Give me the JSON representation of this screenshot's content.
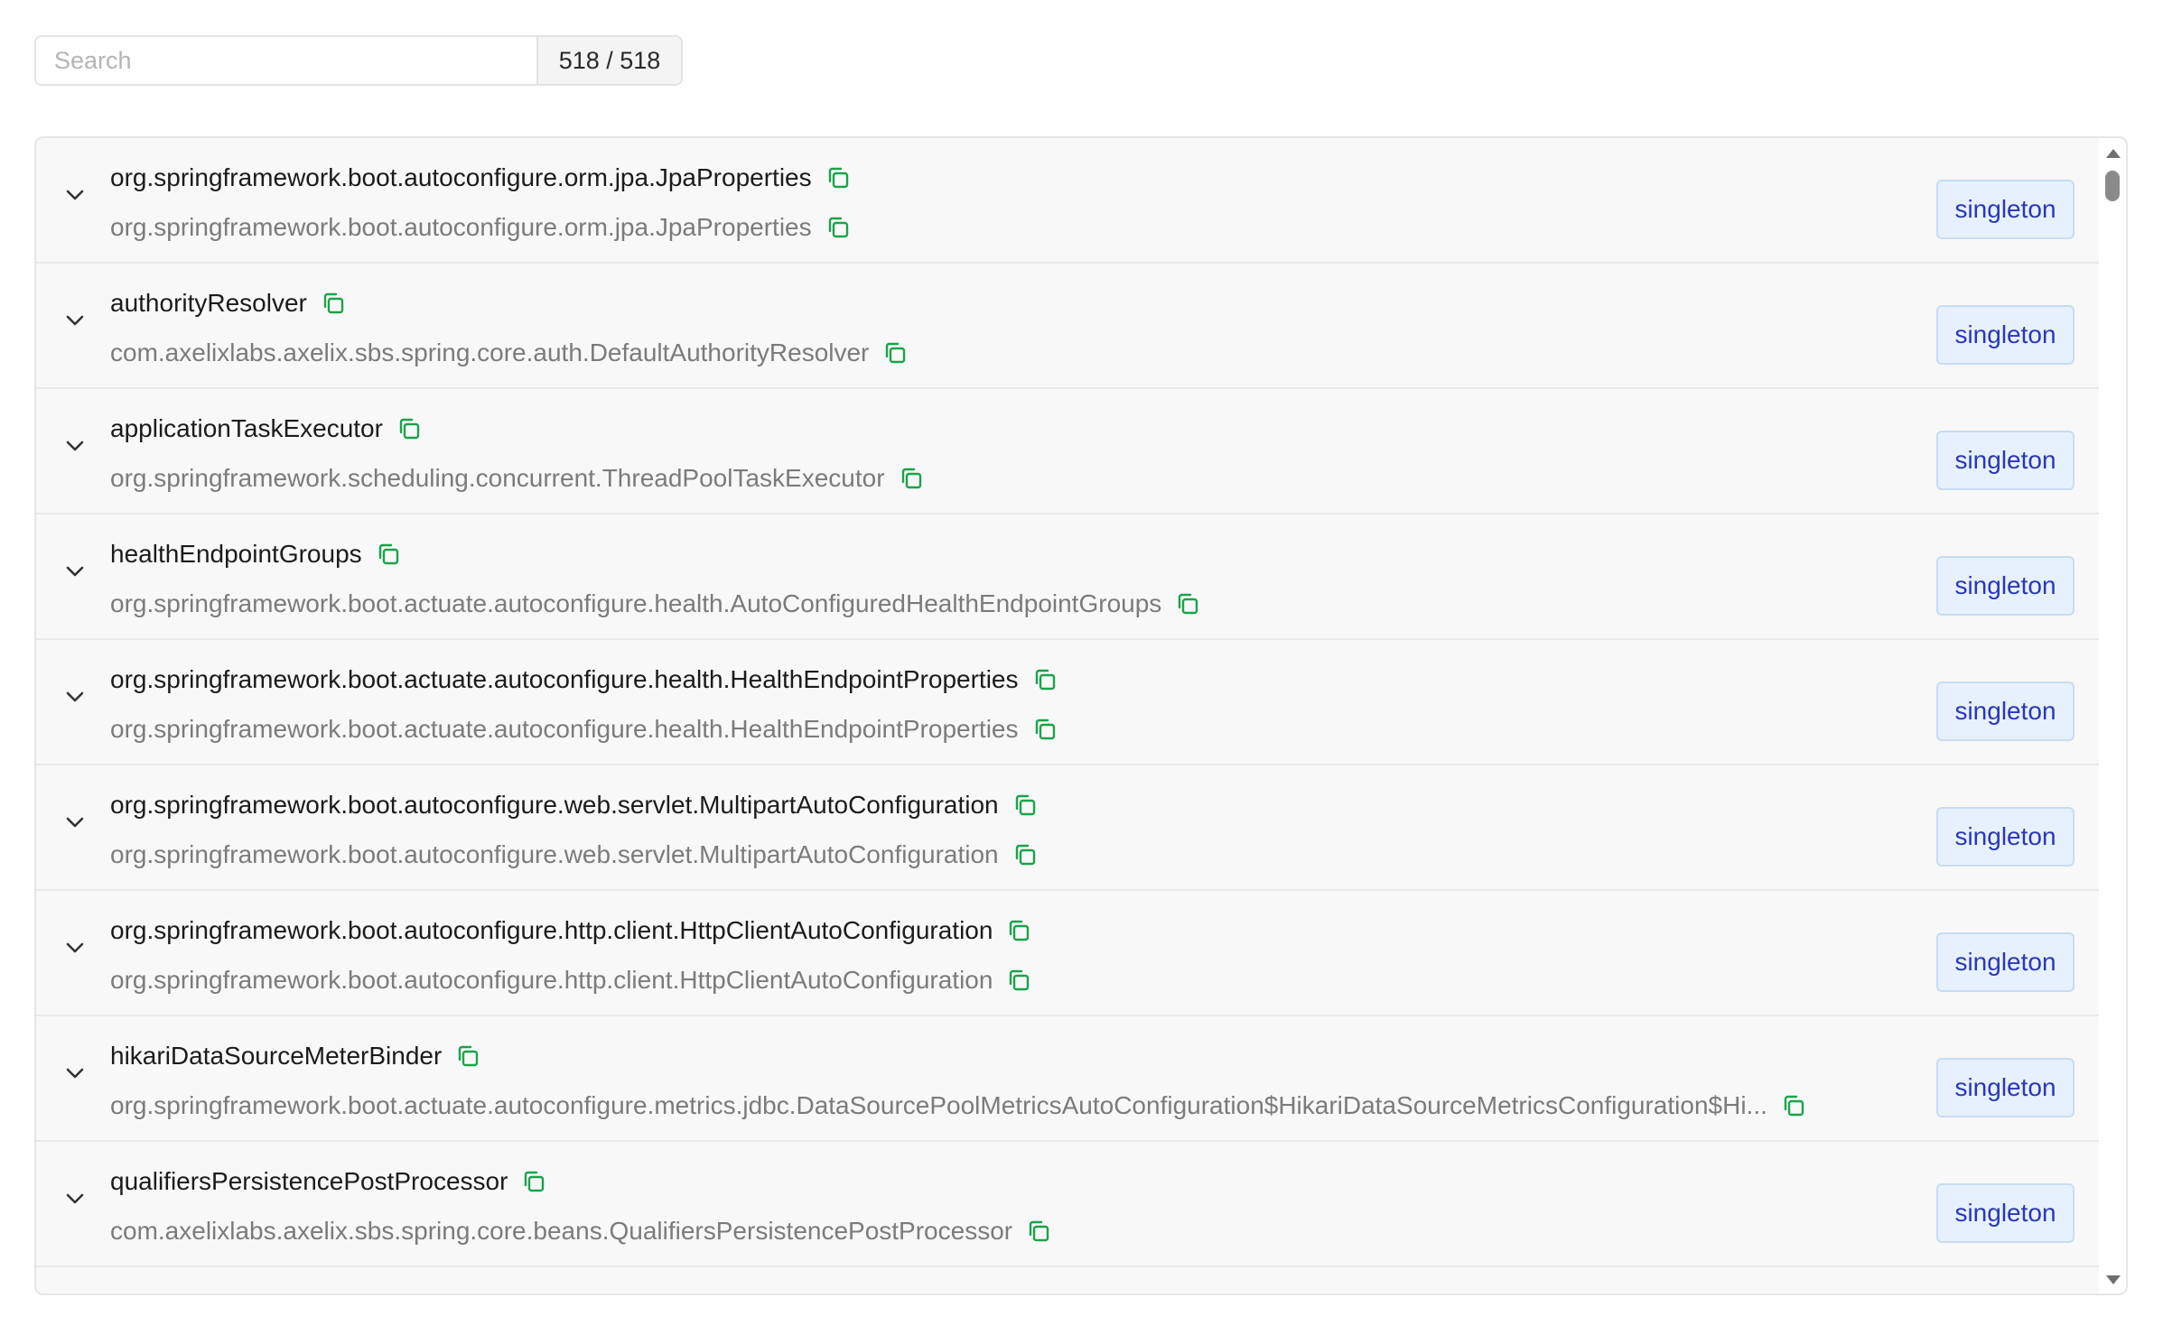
{
  "search": {
    "placeholder": "Search",
    "value": "",
    "count": "518 / 518"
  },
  "colors": {
    "accent_copy": "#1aa34a",
    "badge_bg": "#e6f1fd",
    "badge_text": "#2a37b8"
  },
  "icons": {
    "expand": "chevron-down-icon",
    "copy": "copy-icon"
  },
  "beans": [
    {
      "name": "org.springframework.boot.autoconfigure.orm.jpa.JpaProperties",
      "type": "org.springframework.boot.autoconfigure.orm.jpa.JpaProperties",
      "scope": "singleton"
    },
    {
      "name": "authorityResolver",
      "type": "com.axelixlabs.axelix.sbs.spring.core.auth.DefaultAuthorityResolver",
      "scope": "singleton"
    },
    {
      "name": "applicationTaskExecutor",
      "type": "org.springframework.scheduling.concurrent.ThreadPoolTaskExecutor",
      "scope": "singleton"
    },
    {
      "name": "healthEndpointGroups",
      "type": "org.springframework.boot.actuate.autoconfigure.health.AutoConfiguredHealthEndpointGroups",
      "scope": "singleton"
    },
    {
      "name": "org.springframework.boot.actuate.autoconfigure.health.HealthEndpointProperties",
      "type": "org.springframework.boot.actuate.autoconfigure.health.HealthEndpointProperties",
      "scope": "singleton"
    },
    {
      "name": "org.springframework.boot.autoconfigure.web.servlet.MultipartAutoConfiguration",
      "type": "org.springframework.boot.autoconfigure.web.servlet.MultipartAutoConfiguration",
      "scope": "singleton"
    },
    {
      "name": "org.springframework.boot.autoconfigure.http.client.HttpClientAutoConfiguration",
      "type": "org.springframework.boot.autoconfigure.http.client.HttpClientAutoConfiguration",
      "scope": "singleton"
    },
    {
      "name": "hikariDataSourceMeterBinder",
      "type": "org.springframework.boot.actuate.autoconfigure.metrics.jdbc.DataSourcePoolMetricsAutoConfiguration$HikariDataSourceMetricsConfiguration$Hi...",
      "scope": "singleton"
    },
    {
      "name": "qualifiersPersistencePostProcessor",
      "type": "com.axelixlabs.axelix.sbs.spring.core.beans.QualifiersPersistencePostProcessor",
      "scope": "singleton"
    }
  ]
}
